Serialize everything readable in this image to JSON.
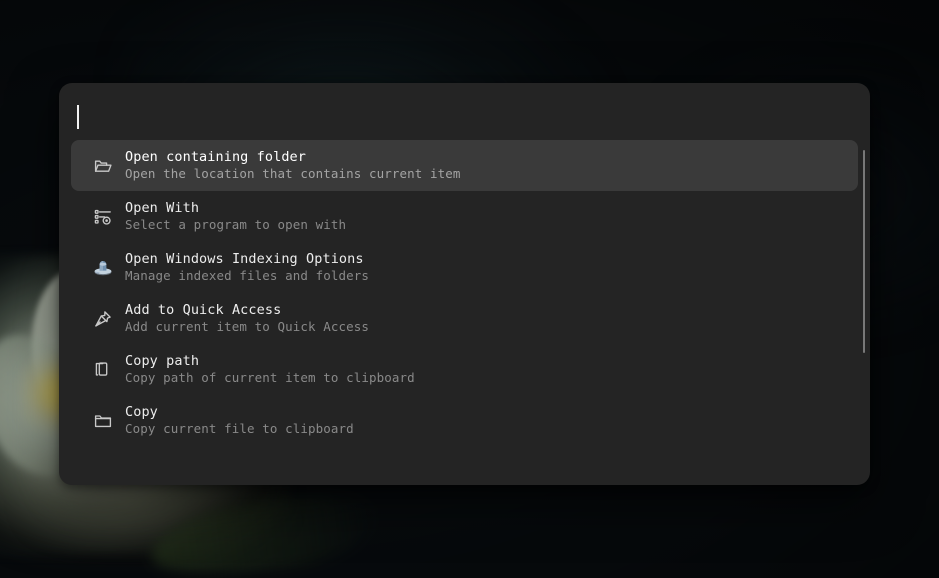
{
  "wallpaper": {
    "description": "dark photo of a white water lily at lower left",
    "background_color": "#080c0f"
  },
  "launcher": {
    "panel_background": "#242424",
    "selection_background": "#3a3a3a",
    "search": {
      "value": "",
      "placeholder": "",
      "caret_visible": true
    },
    "scrollbar": {
      "visible": true,
      "thumb_color": "#787878"
    },
    "results": [
      {
        "icon": "open-folder-icon",
        "title": "Open containing folder",
        "subtitle": "Open the location that contains current item",
        "selected": true
      },
      {
        "icon": "open-with-list-icon",
        "title": "Open With",
        "subtitle": "Select a program to open with",
        "selected": false
      },
      {
        "icon": "windows-indexing-options-icon",
        "title": "Open Windows Indexing Options",
        "subtitle": "Manage indexed files and folders",
        "selected": false
      },
      {
        "icon": "pushpin-icon",
        "title": "Add to Quick Access",
        "subtitle": "Add current item to Quick Access",
        "selected": false
      },
      {
        "icon": "copy-document-icon",
        "title": "Copy path",
        "subtitle": "Copy path of current item to clipboard",
        "selected": false
      },
      {
        "icon": "folder-icon",
        "title": "Copy",
        "subtitle": "Copy current file to clipboard",
        "selected": false
      }
    ]
  }
}
